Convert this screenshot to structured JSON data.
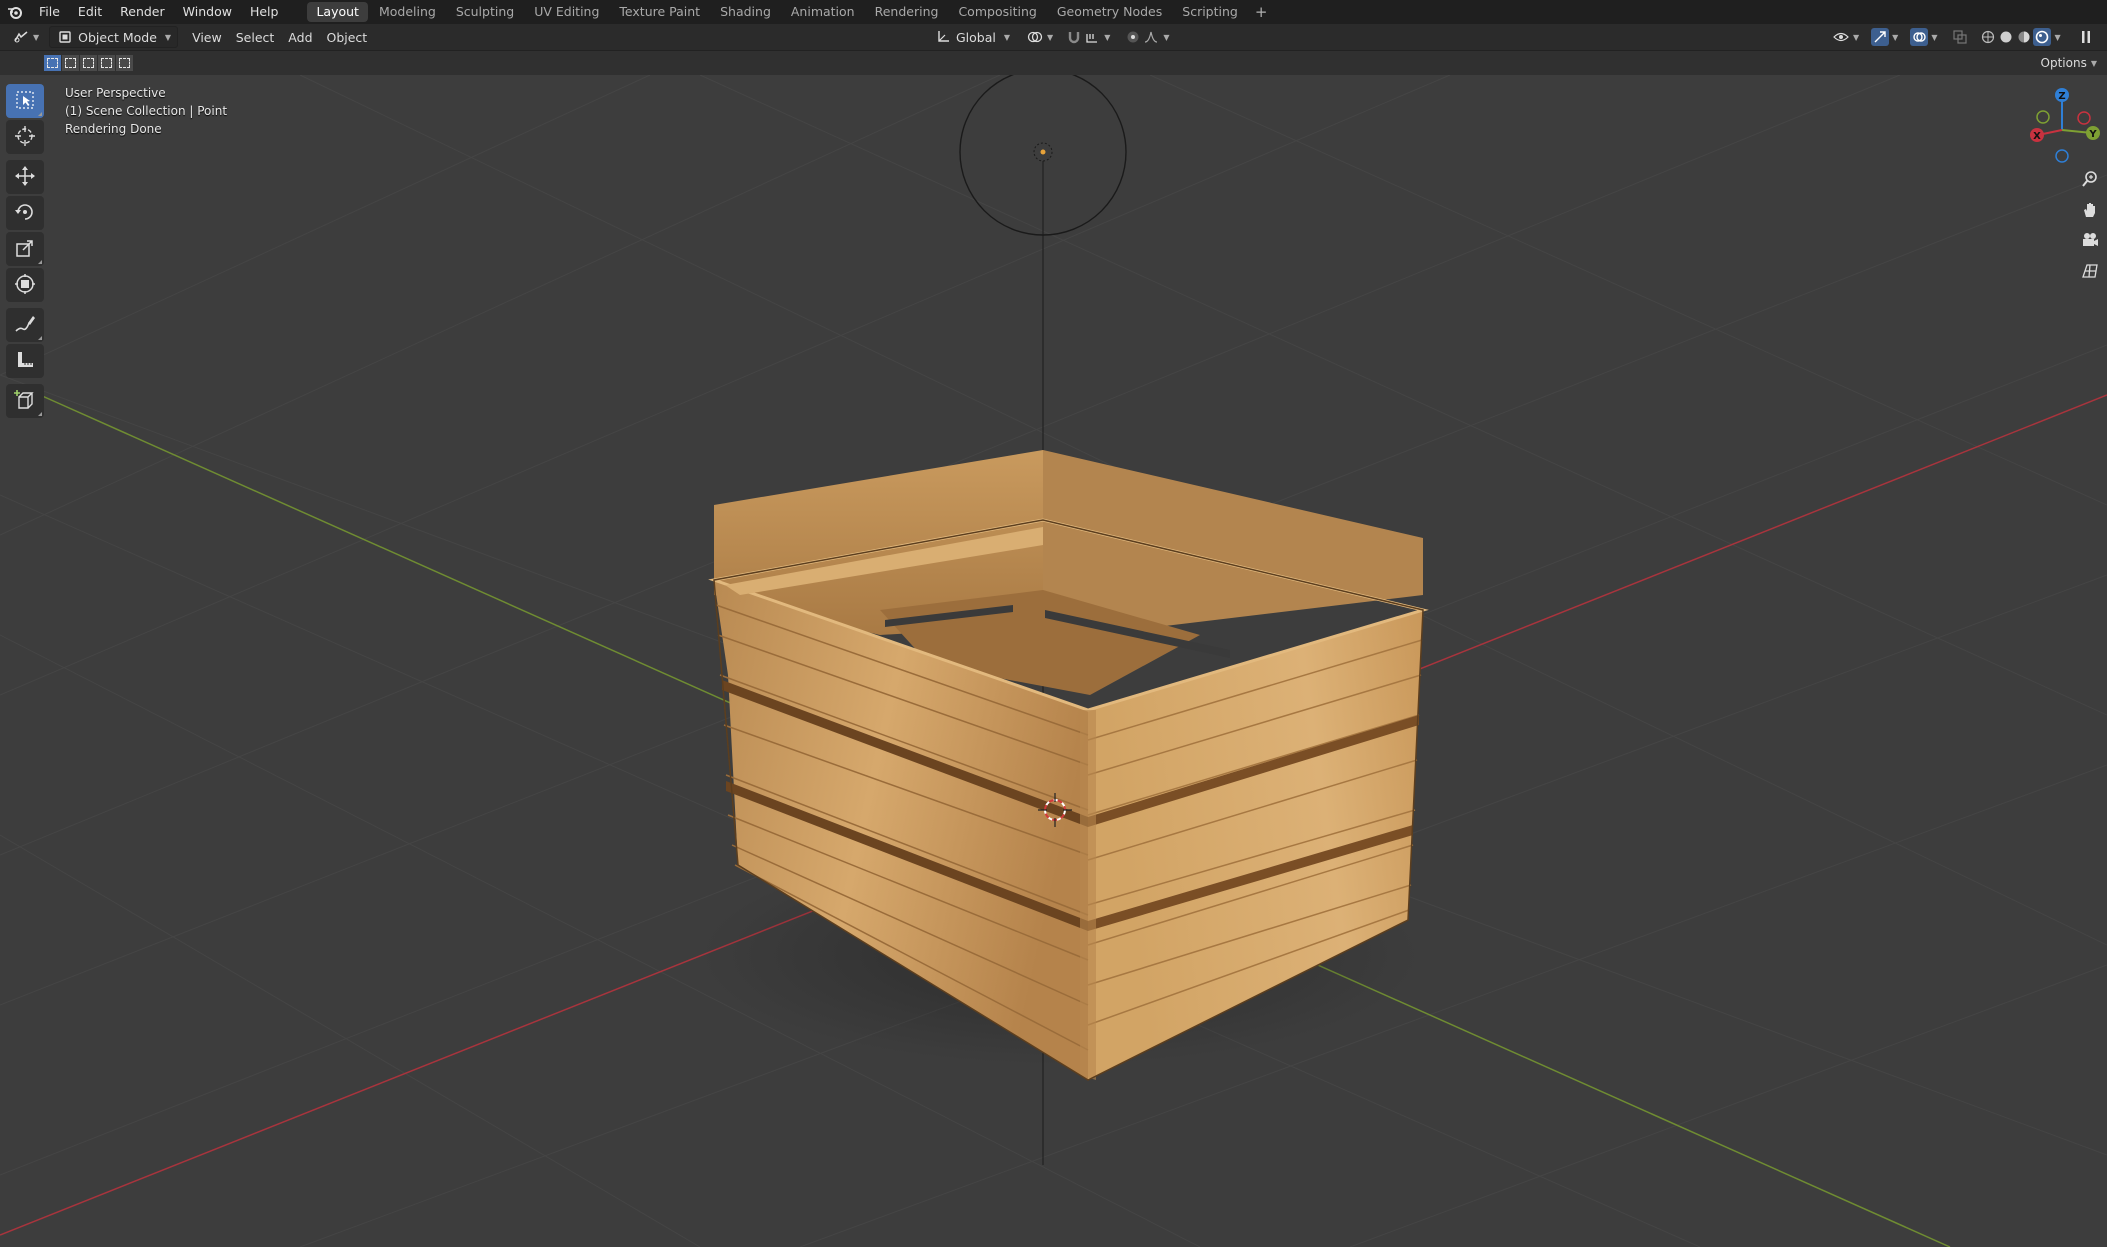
{
  "app": {
    "name": "Blender"
  },
  "topbar": {
    "menus": [
      "File",
      "Edit",
      "Render",
      "Window",
      "Help"
    ],
    "workspaces": [
      "Layout",
      "Modeling",
      "Sculpting",
      "UV Editing",
      "Texture Paint",
      "Shading",
      "Animation",
      "Rendering",
      "Compositing",
      "Geometry Nodes",
      "Scripting"
    ],
    "active_workspace": "Layout",
    "add_workspace": "+"
  },
  "header": {
    "mode": "Object Mode",
    "menus": [
      "View",
      "Select",
      "Add",
      "Object"
    ],
    "orientation": "Global"
  },
  "toolrow": {
    "options_label": "Options"
  },
  "viewport": {
    "info_lines": [
      "User Perspective",
      "(1) Scene Collection | Point",
      "Rendering Done"
    ],
    "gizmo_axes": {
      "z": "Z",
      "y": "Y",
      "x": "X"
    }
  },
  "colors": {
    "accent": "#4772b3",
    "x_axis": "#c8323f",
    "y_axis": "#7ea033",
    "z_axis": "#2f7fd6",
    "background": "#3d3d3d",
    "wood": "#c9995d"
  },
  "icons": {
    "tools": [
      "select-box-icon",
      "cursor-icon",
      "move-icon",
      "rotate-icon",
      "scale-icon",
      "transform-icon",
      "annotate-icon",
      "measure-icon",
      "add-cube-icon"
    ],
    "nav": [
      "zoom-icon",
      "pan-hand-icon",
      "camera-icon",
      "ortho-grid-icon"
    ]
  }
}
